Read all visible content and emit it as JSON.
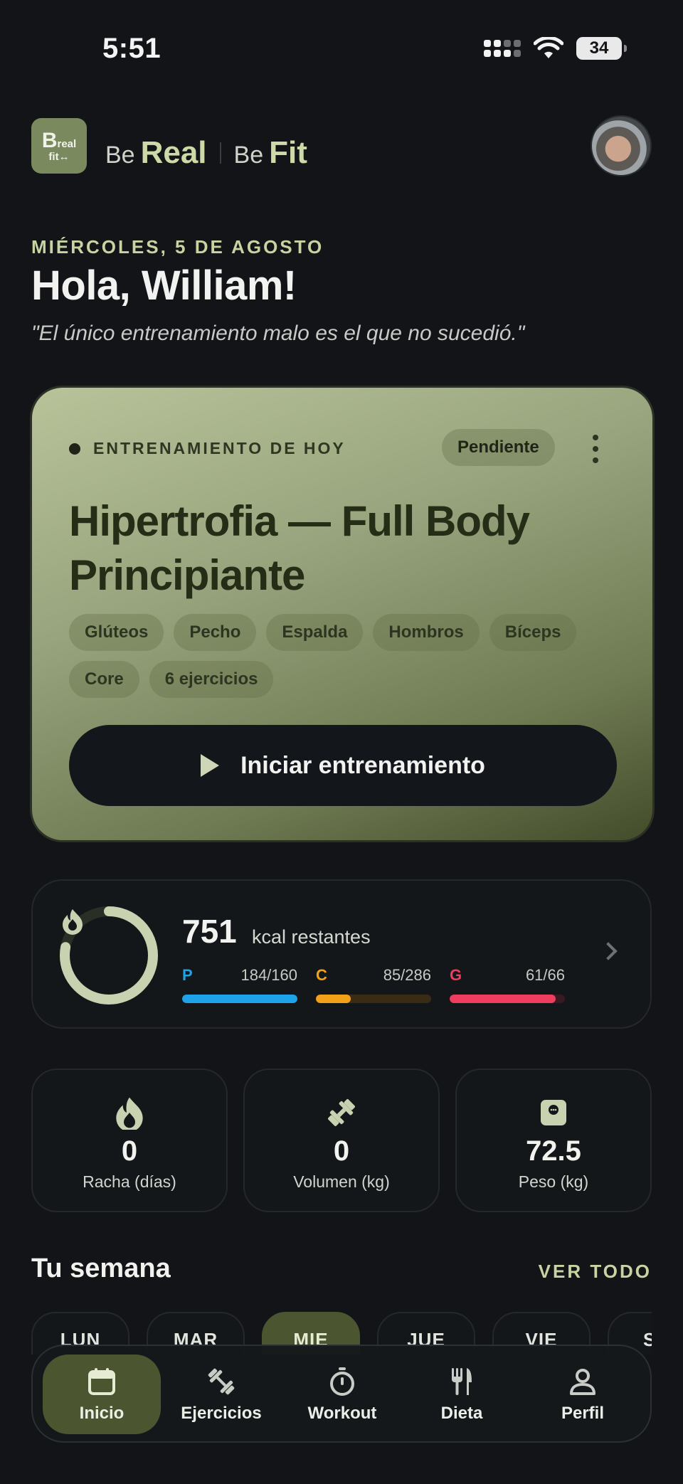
{
  "status": {
    "time": "5:51",
    "battery": "34"
  },
  "header": {
    "logo_text_top": "real",
    "logo_text_bottom": "fit",
    "be_1": "Be",
    "real": "Real",
    "be_2": "Be",
    "fit": "Fit"
  },
  "greeting": {
    "date": "MIÉRCOLES, 5 DE AGOSTO",
    "title": "Hola, William!",
    "quote": "\"El único entrenamiento malo es el que no sucedió.\""
  },
  "workout": {
    "label": "ENTRENAMIENTO DE HOY",
    "status": "Pendiente",
    "title": "Hipertrofia — Full Body Principiante",
    "tags": [
      "Glúteos",
      "Pecho",
      "Espalda",
      "Hombros",
      "Bíceps",
      "Core",
      "6 ejercicios"
    ],
    "start_label": "Iniciar entrenamiento"
  },
  "calories": {
    "value": "751",
    "label": "kcal restantes",
    "ring_progress": 0.78,
    "macros": [
      {
        "key": "P",
        "value": "184/160",
        "color": "#1fa3e8",
        "progress": 1.0
      },
      {
        "key": "C",
        "value": "85/286",
        "color": "#f4a11a",
        "progress": 0.3
      },
      {
        "key": "G",
        "value": "61/66",
        "color": "#ee3d5e",
        "progress": 0.92
      }
    ]
  },
  "stats": [
    {
      "icon": "flame-icon",
      "value": "0",
      "label": "Racha (días)"
    },
    {
      "icon": "dumbbell-icon",
      "value": "0",
      "label": "Volumen (kg)"
    },
    {
      "icon": "scale-icon",
      "value": "72.5",
      "label": "Peso (kg)"
    }
  ],
  "week": {
    "title": "Tu semana",
    "see_all": "VER TODO",
    "days": [
      "LUN",
      "MAR",
      "MIE",
      "JUE",
      "VIE",
      "SA"
    ],
    "active_day": "MIE"
  },
  "nav": {
    "items": [
      {
        "label": "Inicio",
        "icon": "calendar-icon",
        "active": true
      },
      {
        "label": "Ejercicios",
        "icon": "dumbbell-icon",
        "active": false
      },
      {
        "label": "Workout",
        "icon": "stopwatch-icon",
        "active": false
      },
      {
        "label": "Dieta",
        "icon": "fork-knife-icon",
        "active": false
      },
      {
        "label": "Perfil",
        "icon": "user-icon",
        "active": false
      }
    ]
  },
  "colors": {
    "accent": "#c7d3a1",
    "active_bg": "#4b5630",
    "background": "#121418"
  }
}
